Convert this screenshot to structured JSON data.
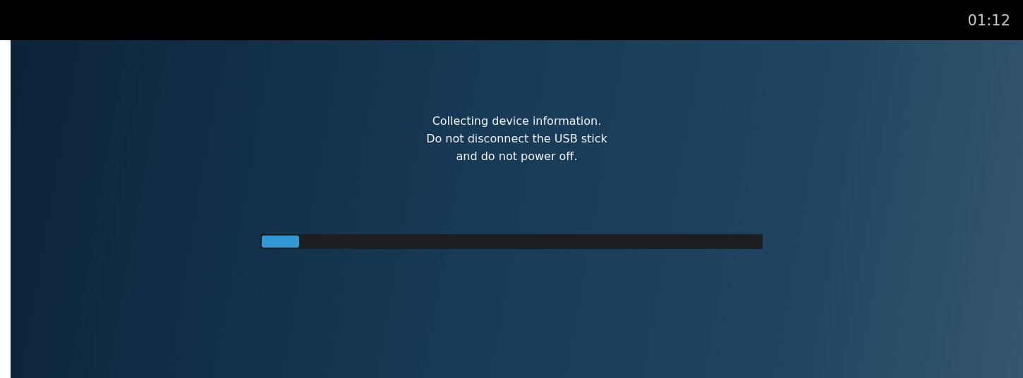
{
  "status_bar": {
    "time": "01:12"
  },
  "message": "Collecting device information.\nDo not disconnect the USB stick\nand do not power off.",
  "progress": {
    "level": 0.075
  }
}
